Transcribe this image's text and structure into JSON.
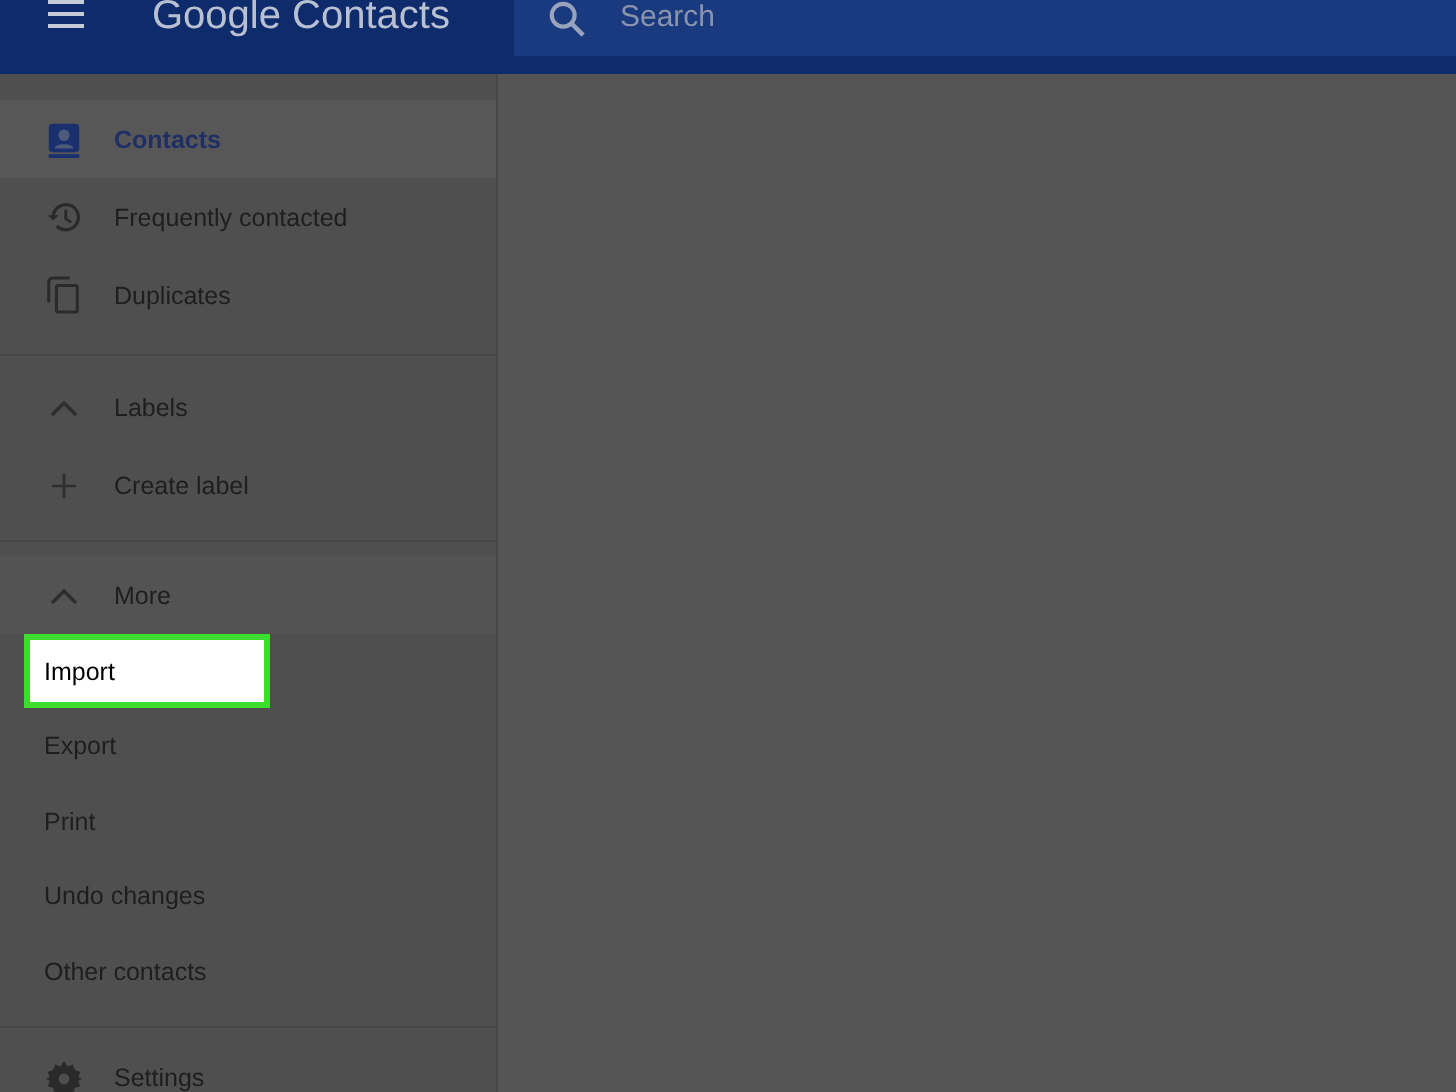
{
  "app_bar": {
    "title": "Google Contacts",
    "search": {
      "placeholder": "Search"
    }
  },
  "nav": [
    {
      "label": "Contacts",
      "kind": "contacts",
      "selected": true
    },
    {
      "label": "Frequently contacted",
      "kind": "history",
      "selected": false
    },
    {
      "label": "Duplicates",
      "kind": "duplicates",
      "selected": false
    }
  ],
  "groups": [
    {
      "label": "Labels",
      "expanded": true,
      "items": [
        {
          "label": "Create label",
          "kind": "add"
        }
      ]
    },
    {
      "label": "More",
      "expanded": true,
      "items": [
        {
          "label": "Import",
          "kind": "action",
          "highlighted": true
        },
        {
          "label": "Export",
          "kind": "action",
          "highlighted": false
        },
        {
          "label": "Print",
          "kind": "action",
          "highlighted": false
        },
        {
          "label": "Undo changes",
          "kind": "action",
          "highlighted": false
        },
        {
          "label": "Other contacts",
          "kind": "action",
          "highlighted": false
        }
      ]
    }
  ],
  "footer": [
    {
      "label": "Settings",
      "kind": "settings"
    }
  ]
}
